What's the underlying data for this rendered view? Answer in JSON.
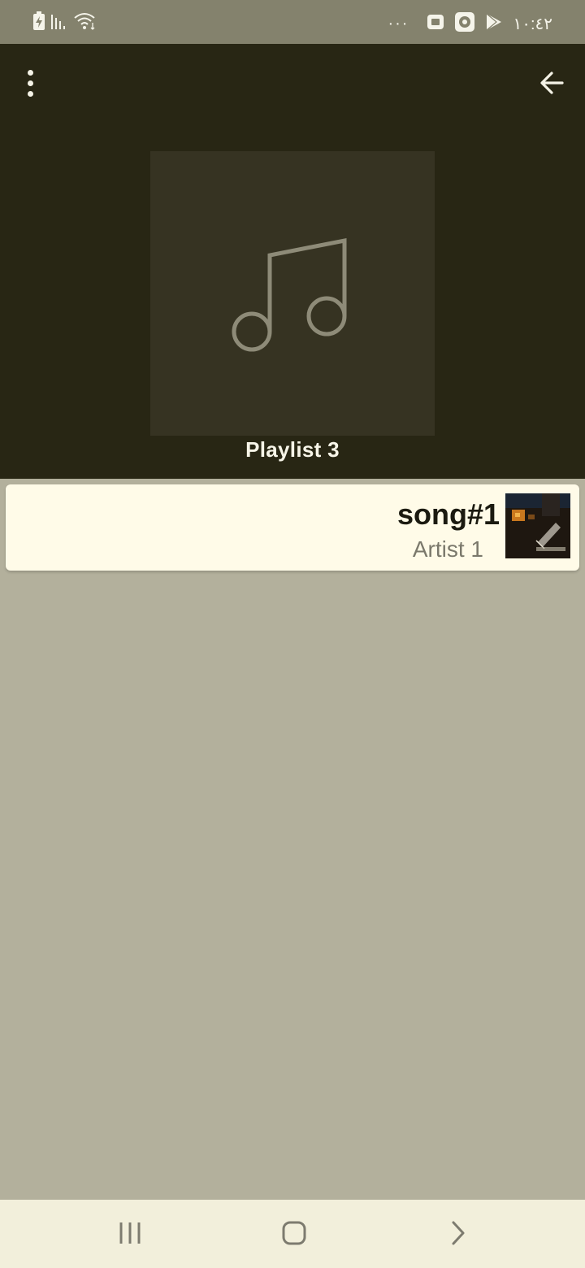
{
  "status_bar": {
    "time": "١٠:٤٢",
    "overflow_dots": "···",
    "icons": [
      "battery-charging-icon",
      "signal-icon",
      "wifi-icon",
      "youtube-notification-icon",
      "app-notification-icon",
      "play-store-icon"
    ]
  },
  "header": {
    "menu_icon": "more-vert-icon",
    "back_icon": "arrow-back-icon",
    "cover_icon": "music-note-icon",
    "playlist_title": "Playlist 3"
  },
  "songs": [
    {
      "title": "song#1",
      "artist": "Artist 1",
      "thumbnail": "album-art"
    }
  ],
  "nav_bar": {
    "recent_icon": "recent-apps-icon",
    "home_icon": "home-icon",
    "back_icon": "nav-back-icon"
  },
  "colors": {
    "status_bar": "#84826d",
    "header_bg": "#282614",
    "cover_bg": "#363322",
    "content_bg": "#b3b09c",
    "card_bg": "#fffbe8",
    "nav_bg": "#f2efdb"
  }
}
